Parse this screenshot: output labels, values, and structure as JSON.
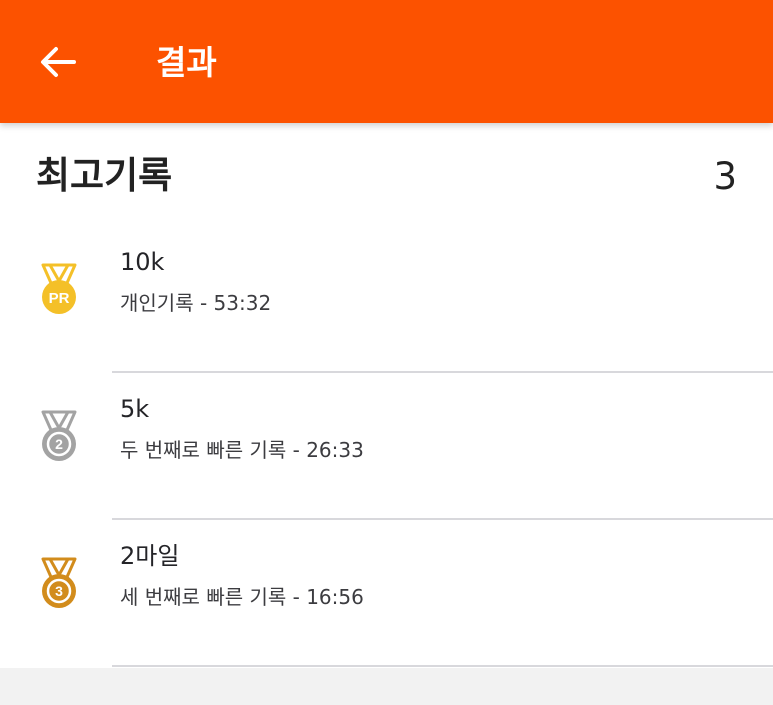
{
  "colors": {
    "accent": "#fc5200",
    "gold": "#f4c028",
    "silver": "#a3a3a3",
    "bronze": "#d28c1c"
  },
  "header": {
    "back_icon": "arrow-left-icon",
    "title": "결과"
  },
  "best_records": {
    "title": "최고기록",
    "count": "3",
    "items": [
      {
        "icon": "pr-medal-icon",
        "title": "10k",
        "subtitle": "개인기록 - 53:32"
      },
      {
        "icon": "second-place-medal-icon",
        "title": "5k",
        "subtitle": "두 번째로 빠른 기록 - 26:33"
      },
      {
        "icon": "third-place-medal-icon",
        "title": "2마일",
        "subtitle": "세 번째로 빠른 기록 - 16:56"
      }
    ]
  }
}
